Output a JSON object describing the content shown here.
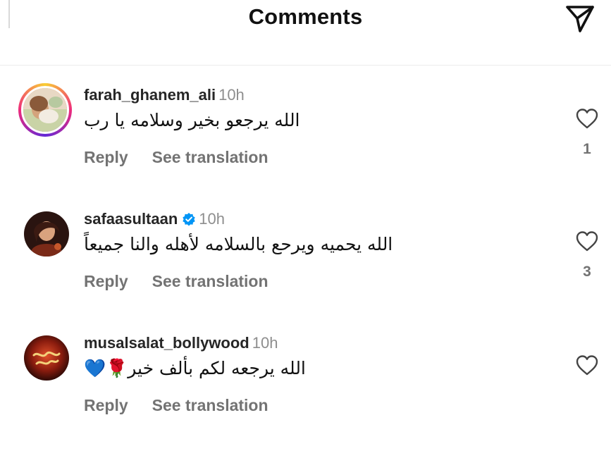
{
  "header": {
    "title": "Comments",
    "share_icon": "paper-plane-icon"
  },
  "comments": [
    {
      "username": "farah_ghanem_ali",
      "time": "10h",
      "verified": false,
      "has_story_ring": true,
      "text": "الله يرجعو بخير وسلامه يا رب",
      "reply_label": "Reply",
      "translate_label": "See translation",
      "like_icon": "heart-outline-icon",
      "like_count": "1"
    },
    {
      "username": "safaasultaan",
      "time": "10h",
      "verified": true,
      "has_story_ring": false,
      "text": "الله يحميه ويرحع بالسلامه لأهله والنا جميعاً",
      "reply_label": "Reply",
      "translate_label": "See translation",
      "like_icon": "heart-outline-icon",
      "like_count": "3"
    },
    {
      "username": "musalsalat_bollywood",
      "time": "10h",
      "verified": false,
      "has_story_ring": false,
      "text": "الله يرجعه لكم بألف خير🌹💙",
      "reply_label": "Reply",
      "translate_label": "See translation",
      "like_icon": "heart-outline-icon",
      "like_count": ""
    }
  ],
  "colors": {
    "text_primary": "#262626",
    "text_secondary": "#737373",
    "timestamp": "#8e8e8e",
    "verified_blue": "#0095f6"
  }
}
